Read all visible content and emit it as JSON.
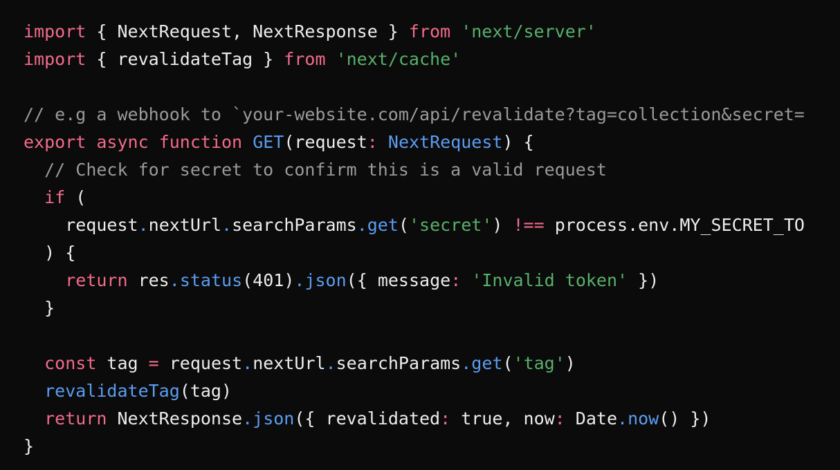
{
  "theme": {
    "background": "#0b0b0c",
    "default": "#ededed",
    "keyword": "#f26b8a",
    "string": "#58b06a",
    "comment": "#9a9a9a",
    "function": "#5b9df0",
    "punct": "#5b9df0"
  },
  "code": {
    "lines": [
      [
        {
          "t": "import",
          "k": "keyword"
        },
        {
          "t": " { NextRequest, NextResponse } ",
          "k": "default"
        },
        {
          "t": "from",
          "k": "keyword"
        },
        {
          "t": " ",
          "k": "default"
        },
        {
          "t": "'next/server'",
          "k": "string"
        }
      ],
      [
        {
          "t": "import",
          "k": "keyword"
        },
        {
          "t": " { revalidateTag } ",
          "k": "default"
        },
        {
          "t": "from",
          "k": "keyword"
        },
        {
          "t": " ",
          "k": "default"
        },
        {
          "t": "'next/cache'",
          "k": "string"
        }
      ],
      [],
      [
        {
          "t": "// e.g a webhook to `your-website.com/api/revalidate?tag=collection&secret=",
          "k": "comment"
        }
      ],
      [
        {
          "t": "export",
          "k": "keyword"
        },
        {
          "t": " ",
          "k": "default"
        },
        {
          "t": "async",
          "k": "keyword"
        },
        {
          "t": " ",
          "k": "default"
        },
        {
          "t": "function",
          "k": "keyword"
        },
        {
          "t": " ",
          "k": "default"
        },
        {
          "t": "GET",
          "k": "function"
        },
        {
          "t": "(request",
          "k": "default"
        },
        {
          "t": ":",
          "k": "keyword"
        },
        {
          "t": " ",
          "k": "default"
        },
        {
          "t": "NextRequest",
          "k": "function"
        },
        {
          "t": ") {",
          "k": "default"
        }
      ],
      [
        {
          "t": "  ",
          "k": "default"
        },
        {
          "t": "// Check for secret to confirm this is a valid request",
          "k": "comment"
        }
      ],
      [
        {
          "t": "  ",
          "k": "default"
        },
        {
          "t": "if",
          "k": "keyword"
        },
        {
          "t": " (",
          "k": "default"
        }
      ],
      [
        {
          "t": "    request",
          "k": "default"
        },
        {
          "t": ".",
          "k": "punct"
        },
        {
          "t": "nextUrl",
          "k": "default"
        },
        {
          "t": ".",
          "k": "punct"
        },
        {
          "t": "searchParams",
          "k": "default"
        },
        {
          "t": ".",
          "k": "punct"
        },
        {
          "t": "get",
          "k": "function"
        },
        {
          "t": "(",
          "k": "default"
        },
        {
          "t": "'secret'",
          "k": "string"
        },
        {
          "t": ") ",
          "k": "default"
        },
        {
          "t": "!==",
          "k": "keyword"
        },
        {
          "t": " process.env.MY_SECRET_TO",
          "k": "default"
        }
      ],
      [
        {
          "t": "  ) {",
          "k": "default"
        }
      ],
      [
        {
          "t": "    ",
          "k": "default"
        },
        {
          "t": "return",
          "k": "keyword"
        },
        {
          "t": " res",
          "k": "default"
        },
        {
          "t": ".",
          "k": "punct"
        },
        {
          "t": "status",
          "k": "function"
        },
        {
          "t": "(401)",
          "k": "default"
        },
        {
          "t": ".",
          "k": "punct"
        },
        {
          "t": "json",
          "k": "function"
        },
        {
          "t": "({ message",
          "k": "default"
        },
        {
          "t": ":",
          "k": "keyword"
        },
        {
          "t": " ",
          "k": "default"
        },
        {
          "t": "'Invalid token'",
          "k": "string"
        },
        {
          "t": " })",
          "k": "default"
        }
      ],
      [
        {
          "t": "  }",
          "k": "default"
        }
      ],
      [],
      [
        {
          "t": "  ",
          "k": "default"
        },
        {
          "t": "const",
          "k": "keyword"
        },
        {
          "t": " tag ",
          "k": "default"
        },
        {
          "t": "=",
          "k": "keyword"
        },
        {
          "t": " request",
          "k": "default"
        },
        {
          "t": ".",
          "k": "punct"
        },
        {
          "t": "nextUrl",
          "k": "default"
        },
        {
          "t": ".",
          "k": "punct"
        },
        {
          "t": "searchParams",
          "k": "default"
        },
        {
          "t": ".",
          "k": "punct"
        },
        {
          "t": "get",
          "k": "function"
        },
        {
          "t": "(",
          "k": "default"
        },
        {
          "t": "'tag'",
          "k": "string"
        },
        {
          "t": ")",
          "k": "default"
        }
      ],
      [
        {
          "t": "  ",
          "k": "default"
        },
        {
          "t": "revalidateTag",
          "k": "function"
        },
        {
          "t": "(tag)",
          "k": "default"
        }
      ],
      [
        {
          "t": "  ",
          "k": "default"
        },
        {
          "t": "return",
          "k": "keyword"
        },
        {
          "t": " NextResponse",
          "k": "default"
        },
        {
          "t": ".",
          "k": "punct"
        },
        {
          "t": "json",
          "k": "function"
        },
        {
          "t": "({ revalidated",
          "k": "default"
        },
        {
          "t": ":",
          "k": "keyword"
        },
        {
          "t": " true, now",
          "k": "default"
        },
        {
          "t": ":",
          "k": "keyword"
        },
        {
          "t": " Date",
          "k": "default"
        },
        {
          "t": ".",
          "k": "punct"
        },
        {
          "t": "now",
          "k": "function"
        },
        {
          "t": "() })",
          "k": "default"
        }
      ],
      [
        {
          "t": "}",
          "k": "default"
        }
      ]
    ]
  }
}
